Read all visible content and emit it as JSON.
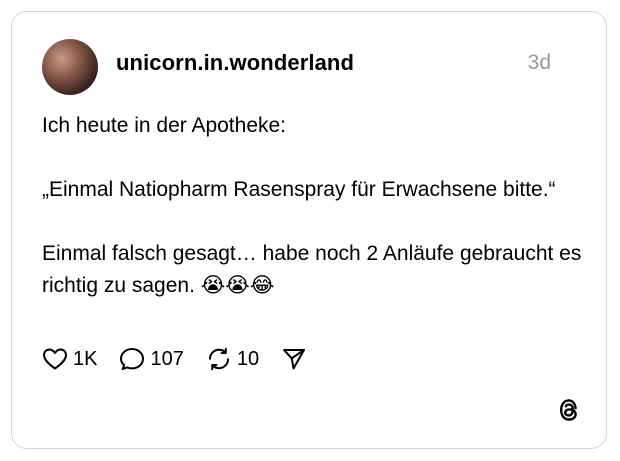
{
  "post": {
    "username": "unicorn.in.wonderland",
    "timestamp": "3d",
    "lines": [
      "Ich heute in der Apotheke:",
      "„Einmal Natiopharm Rasenspray für Erwachsene bitte.“",
      "Einmal falsch gesagt… habe noch 2 Anläufe gebraucht es richtig zu sagen. 😭😭😂"
    ]
  },
  "actions": {
    "like_count": "1K",
    "reply_count": "107",
    "repost_count": "10"
  },
  "icons": {
    "like": "heart-icon",
    "reply": "speech-bubble-icon",
    "repost": "repost-icon",
    "share": "send-icon",
    "brand": "threads-logo-icon"
  }
}
